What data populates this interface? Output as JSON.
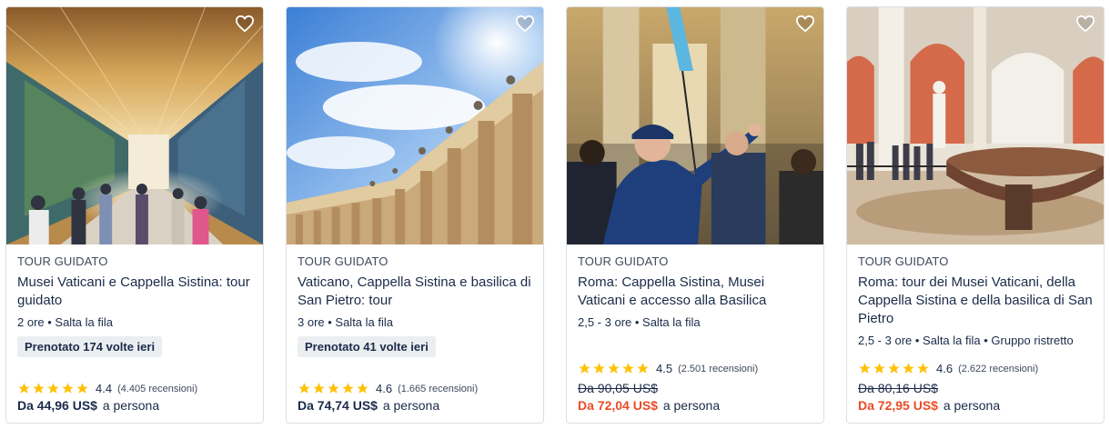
{
  "colors": {
    "star": "#ffc107",
    "sale_price": "#eb4b26",
    "text": "#1a2b49",
    "badge_bg": "#ebeef1"
  },
  "wishlist_icon": "heart-outline-icon",
  "cards": [
    {
      "category": "TOUR GUIDATO",
      "title": "Musei Vaticani e Cappella Sistina: tour guidato",
      "meta": "2 ore • Salta la fila",
      "badge": "Prenotato 174 volte ieri",
      "rating": "4.4",
      "reviews": "(4.405 recensioni)",
      "old_price": "",
      "price": "Da 44,96 US$",
      "per": "a persona"
    },
    {
      "category": "TOUR GUIDATO",
      "title": "Vaticano, Cappella Sistina e basilica di San Pietro: tour",
      "meta": "3 ore • Salta la fila",
      "badge": "Prenotato 41 volte ieri",
      "rating": "4.6",
      "reviews": "(1.665 recensioni)",
      "old_price": "",
      "price": "Da 74,74 US$",
      "per": "a persona"
    },
    {
      "category": "TOUR GUIDATO",
      "title": "Roma: Cappella Sistina, Musei Vaticani e accesso alla Basilica",
      "meta": "2,5 - 3 ore • Salta la fila",
      "badge": "",
      "rating": "4.5",
      "reviews": "(2.501 recensioni)",
      "old_price": "Da 90,05 US$",
      "price": "Da 72,04 US$",
      "per": "a persona"
    },
    {
      "category": "TOUR GUIDATO",
      "title": "Roma: tour dei Musei Vaticani, della Cappella Sistina e della basilica di San Pietro",
      "meta": "2,5 - 3 ore • Salta la fila • Gruppo ristretto",
      "badge": "",
      "rating": "4.6",
      "reviews": "(2.622 recensioni)",
      "old_price": "Da 80,16 US$",
      "price": "Da 72,95 US$",
      "per": "a persona"
    }
  ]
}
